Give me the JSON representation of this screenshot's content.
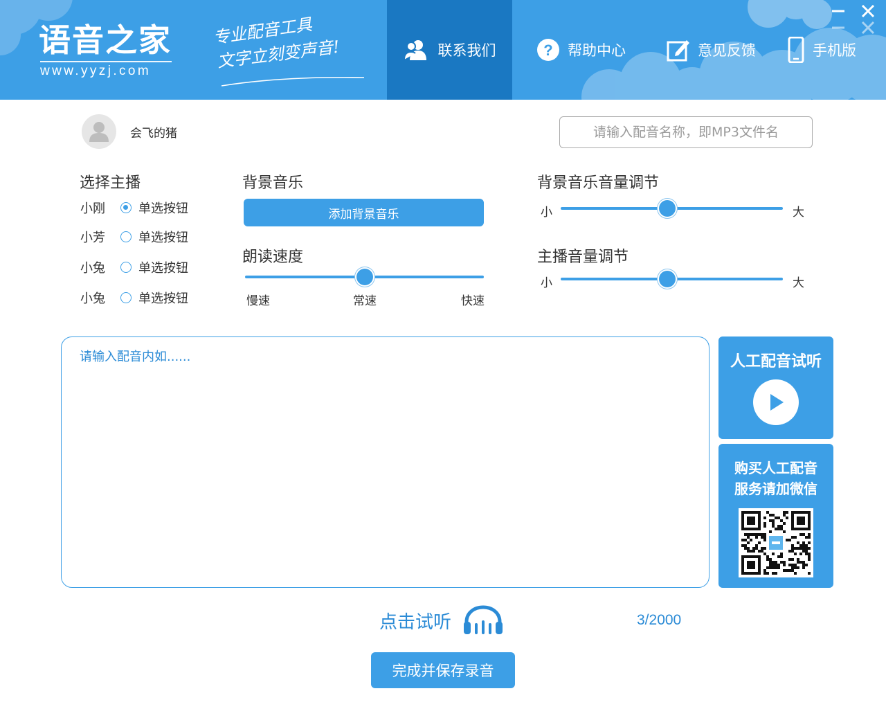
{
  "header": {
    "logo_title": "语音之家",
    "logo_url": "www.yyzj.com",
    "slogan_line1": "专业配音工具",
    "slogan_line2": "文字立刻变声音!",
    "nav": {
      "contact": "联系我们",
      "help": "帮助中心",
      "feedback": "意见反馈",
      "mobile": "手机版"
    }
  },
  "user": {
    "name": "会飞的猪"
  },
  "filename": {
    "placeholder": "请输入配音名称，即MP3文件名",
    "value": ""
  },
  "anchor": {
    "title": "选择主播",
    "options": [
      {
        "name": "小刚",
        "label": "单选按钮",
        "checked": true
      },
      {
        "name": "小芳",
        "label": "单选按钮",
        "checked": false
      },
      {
        "name": "小兔",
        "label": "单选按钮",
        "checked": false
      },
      {
        "name": "小兔",
        "label": "单选按钮",
        "checked": false
      }
    ]
  },
  "bgm": {
    "title": "背景音乐",
    "add_button": "添加背景音乐"
  },
  "speed": {
    "title": "朗读速度",
    "slow": "慢速",
    "normal": "常速",
    "fast": "快速",
    "value": 0.5
  },
  "bgm_volume": {
    "title": "背景音乐音量调节",
    "min": "小",
    "max": "大",
    "value": 0.48
  },
  "anchor_volume": {
    "title": "主播音量调节",
    "min": "小",
    "max": "大",
    "value": 0.48
  },
  "content": {
    "placeholder": "请输入配音内如......",
    "value": ""
  },
  "preview_panel": {
    "title": "人工配音试听"
  },
  "buy_panel": {
    "line1": "购买人工配音",
    "line2": "服务请加微信"
  },
  "listen": {
    "label": "点击试听"
  },
  "counter": {
    "text": "3/2000"
  },
  "save_button": "完成并保存录音",
  "colors": {
    "primary": "#3d9fe6",
    "nav_active": "#1a78c2",
    "accent_text": "#2b8bd6"
  }
}
